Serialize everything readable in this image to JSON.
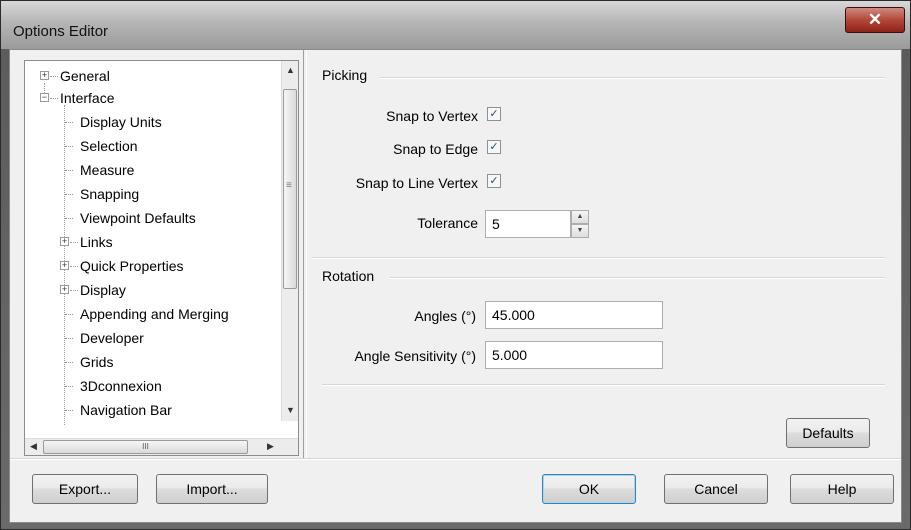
{
  "window": {
    "title": "Options Editor",
    "close_glyph": "✕"
  },
  "tree": {
    "items": [
      {
        "label": "General",
        "level": 0,
        "expander": "+"
      },
      {
        "label": "Interface",
        "level": 0,
        "expander": "−"
      },
      {
        "label": "Display Units",
        "level": 1
      },
      {
        "label": "Selection",
        "level": 1
      },
      {
        "label": "Measure",
        "level": 1
      },
      {
        "label": "Snapping",
        "level": 1
      },
      {
        "label": "Viewpoint Defaults",
        "level": 1
      },
      {
        "label": "Links",
        "level": 1,
        "expander": "+"
      },
      {
        "label": "Quick Properties",
        "level": 1,
        "expander": "+"
      },
      {
        "label": "Display",
        "level": 1,
        "expander": "+"
      },
      {
        "label": "Appending and Merging",
        "level": 1
      },
      {
        "label": "Developer",
        "level": 1
      },
      {
        "label": "Grids",
        "level": 1
      },
      {
        "label": "3Dconnexion",
        "level": 1
      },
      {
        "label": "Navigation Bar",
        "level": 1
      }
    ],
    "scroll_up": "▲",
    "scroll_down": "▼",
    "scroll_left": "◀",
    "scroll_right": "▶",
    "vgrip": "≡",
    "hgrip": "III"
  },
  "picking": {
    "heading": "Picking",
    "snap_vertex_label": "Snap to Vertex",
    "snap_vertex_checked": true,
    "snap_edge_label": "Snap to Edge",
    "snap_edge_checked": true,
    "snap_line_vertex_label": "Snap to Line Vertex",
    "snap_line_vertex_checked": true,
    "tolerance_label": "Tolerance",
    "tolerance_value": "5",
    "spin_up": "▲",
    "spin_down": "▼",
    "check_glyph": "✓"
  },
  "rotation": {
    "heading": "Rotation",
    "angles_label": "Angles (°)",
    "angles_value": "45.000",
    "sensitivity_label": "Angle Sensitivity (°)",
    "sensitivity_value": "5.000"
  },
  "buttons": {
    "defaults": "Defaults",
    "export": "Export...",
    "import": "Import...",
    "ok": "OK",
    "cancel": "Cancel",
    "help": "Help"
  }
}
